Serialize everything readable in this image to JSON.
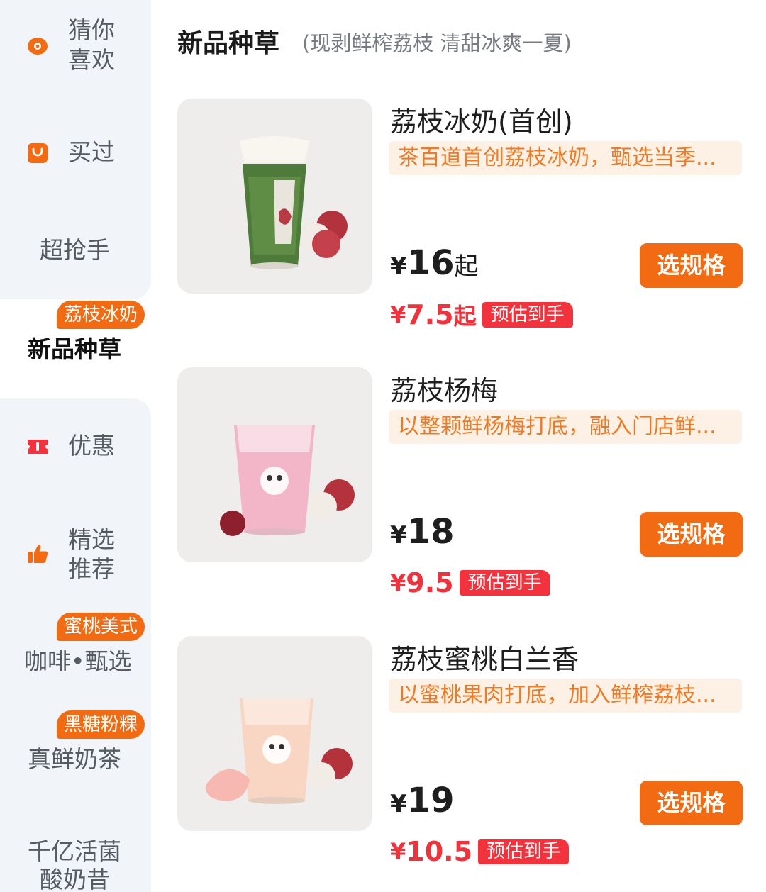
{
  "sidebar": {
    "items": [
      {
        "line1": "猜你",
        "line2": "喜欢",
        "icon": "eye-icon"
      },
      {
        "label": "买过",
        "icon": "shopping-bag-icon"
      },
      {
        "label": "超抢手"
      },
      {
        "label": "新品种草",
        "tag": "荔枝冰奶",
        "active": true
      },
      {
        "label": "优惠",
        "icon": "coupon-icon"
      },
      {
        "line1": "精选",
        "line2": "推荐",
        "icon": "thumbs-up-icon"
      },
      {
        "label": "咖啡•甄选",
        "tag": "蜜桃美式"
      },
      {
        "label": "真鲜奶茶",
        "tag": "黑糖粉粿"
      },
      {
        "line1": "千亿活菌",
        "line2": "酸奶昔"
      }
    ]
  },
  "main": {
    "section_title": "新品种草",
    "section_subtitle": "(现剥鲜榨荔枝 清甜冰爽一夏)",
    "products": [
      {
        "name": "荔枝冰奶(首创)",
        "desc": "茶百道首创荔枝冰奶，甄选当季...",
        "currency": "¥",
        "price": "16",
        "price_suffix": "起",
        "deal_price": "7.5",
        "deal_suffix": "起",
        "deal_badge": "预估到手",
        "button": "选规格"
      },
      {
        "name": "荔枝杨梅",
        "desc": "以整颗鲜杨梅打底，融入门店鲜...",
        "currency": "¥",
        "price": "18",
        "price_suffix": "",
        "deal_price": "9.5",
        "deal_suffix": "",
        "deal_badge": "预估到手",
        "button": "选规格"
      },
      {
        "name": "荔枝蜜桃白兰香",
        "desc": "以蜜桃果肉打底，加入鲜榨荔枝...",
        "currency": "¥",
        "price": "19",
        "price_suffix": "",
        "deal_price": "10.5",
        "deal_suffix": "",
        "deal_badge": "预估到手",
        "button": "选规格"
      }
    ]
  },
  "colors": {
    "accent_orange": "#f26b12",
    "deal_red": "#f0323c",
    "desc_text": "#ee7a26",
    "desc_bg": "#fdf1e6",
    "sidebar_bg": "#f1f4f8"
  }
}
